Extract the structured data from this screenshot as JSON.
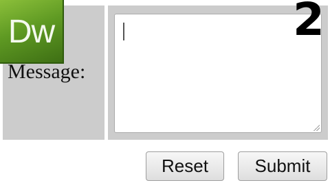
{
  "app": {
    "logo_text": "Dw"
  },
  "overlay": {
    "step_number": "2"
  },
  "form": {
    "message_label": "Message:",
    "message_value": "",
    "reset_label": "Reset",
    "submit_label": "Submit"
  },
  "colors": {
    "cell_background": "#cccccc",
    "logo_green": "#5f9a23",
    "button_face": "#e6e6e6"
  },
  "icons": {
    "logo": "dreamweaver-logo-icon",
    "grip": "resize-grip-icon"
  }
}
